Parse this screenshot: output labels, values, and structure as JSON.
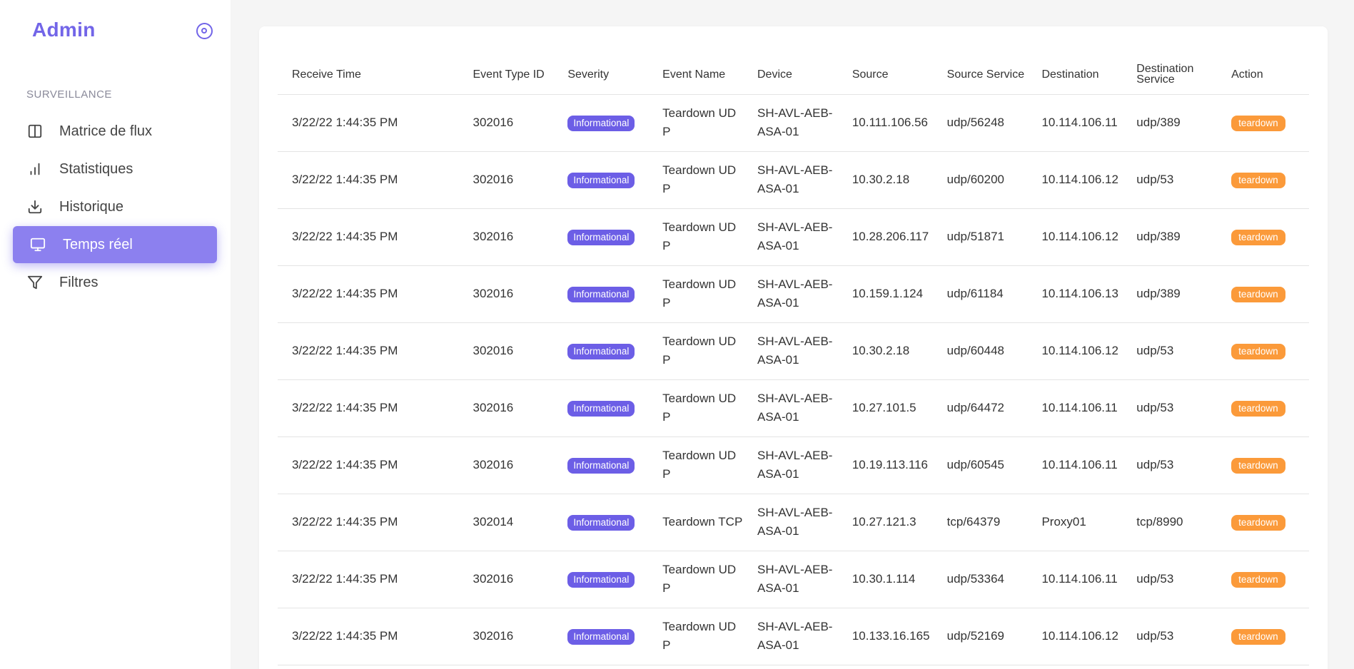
{
  "sidebar": {
    "title": "Admin",
    "section": "SURVEILLANCE",
    "items": [
      {
        "label": "Matrice de flux",
        "icon": "columns-icon"
      },
      {
        "label": "Statistiques",
        "icon": "bar-chart-icon"
      },
      {
        "label": "Historique",
        "icon": "download-icon"
      },
      {
        "label": "Temps réel",
        "icon": "monitor-icon",
        "active": true
      },
      {
        "label": "Filtres",
        "icon": "filter-icon"
      }
    ]
  },
  "table": {
    "columns": [
      "Receive Time",
      "Event Type ID",
      "Severity",
      "Event Name",
      "Device",
      "Source",
      "Source Service",
      "Destination",
      "Destination Service",
      "Action"
    ],
    "rows": [
      [
        "3/22/22 1:44:35 PM",
        "302016",
        "Informational",
        "Teardown UDP",
        "SH-AVL-AEB-ASA-01",
        "10.111.106.56",
        "udp/56248",
        "10.114.106.11",
        "udp/389",
        "teardown"
      ],
      [
        "3/22/22 1:44:35 PM",
        "302016",
        "Informational",
        "Teardown UDP",
        "SH-AVL-AEB-ASA-01",
        "10.30.2.18",
        "udp/60200",
        "10.114.106.12",
        "udp/53",
        "teardown"
      ],
      [
        "3/22/22 1:44:35 PM",
        "302016",
        "Informational",
        "Teardown UDP",
        "SH-AVL-AEB-ASA-01",
        "10.28.206.117",
        "udp/51871",
        "10.114.106.12",
        "udp/389",
        "teardown"
      ],
      [
        "3/22/22 1:44:35 PM",
        "302016",
        "Informational",
        "Teardown UDP",
        "SH-AVL-AEB-ASA-01",
        "10.159.1.124",
        "udp/61184",
        "10.114.106.13",
        "udp/389",
        "teardown"
      ],
      [
        "3/22/22 1:44:35 PM",
        "302016",
        "Informational",
        "Teardown UDP",
        "SH-AVL-AEB-ASA-01",
        "10.30.2.18",
        "udp/60448",
        "10.114.106.12",
        "udp/53",
        "teardown"
      ],
      [
        "3/22/22 1:44:35 PM",
        "302016",
        "Informational",
        "Teardown UDP",
        "SH-AVL-AEB-ASA-01",
        "10.27.101.5",
        "udp/64472",
        "10.114.106.11",
        "udp/53",
        "teardown"
      ],
      [
        "3/22/22 1:44:35 PM",
        "302016",
        "Informational",
        "Teardown UDP",
        "SH-AVL-AEB-ASA-01",
        "10.19.113.116",
        "udp/60545",
        "10.114.106.11",
        "udp/53",
        "teardown"
      ],
      [
        "3/22/22 1:44:35 PM",
        "302014",
        "Informational",
        "Teardown TCP",
        "SH-AVL-AEB-ASA-01",
        "10.27.121.3",
        "tcp/64379",
        "Proxy01",
        "tcp/8990",
        "teardown"
      ],
      [
        "3/22/22 1:44:35 PM",
        "302016",
        "Informational",
        "Teardown UDP",
        "SH-AVL-AEB-ASA-01",
        "10.30.1.114",
        "udp/53364",
        "10.114.106.11",
        "udp/53",
        "teardown"
      ],
      [
        "3/22/22 1:44:35 PM",
        "302016",
        "Informational",
        "Teardown UDP",
        "SH-AVL-AEB-ASA-01",
        "10.133.16.165",
        "udp/52169",
        "10.114.106.12",
        "udp/53",
        "teardown"
      ]
    ]
  },
  "colors": {
    "accent": "#7265e8",
    "severity_badge": "#6c5ee6",
    "action_badge": "#fb9a3a"
  }
}
